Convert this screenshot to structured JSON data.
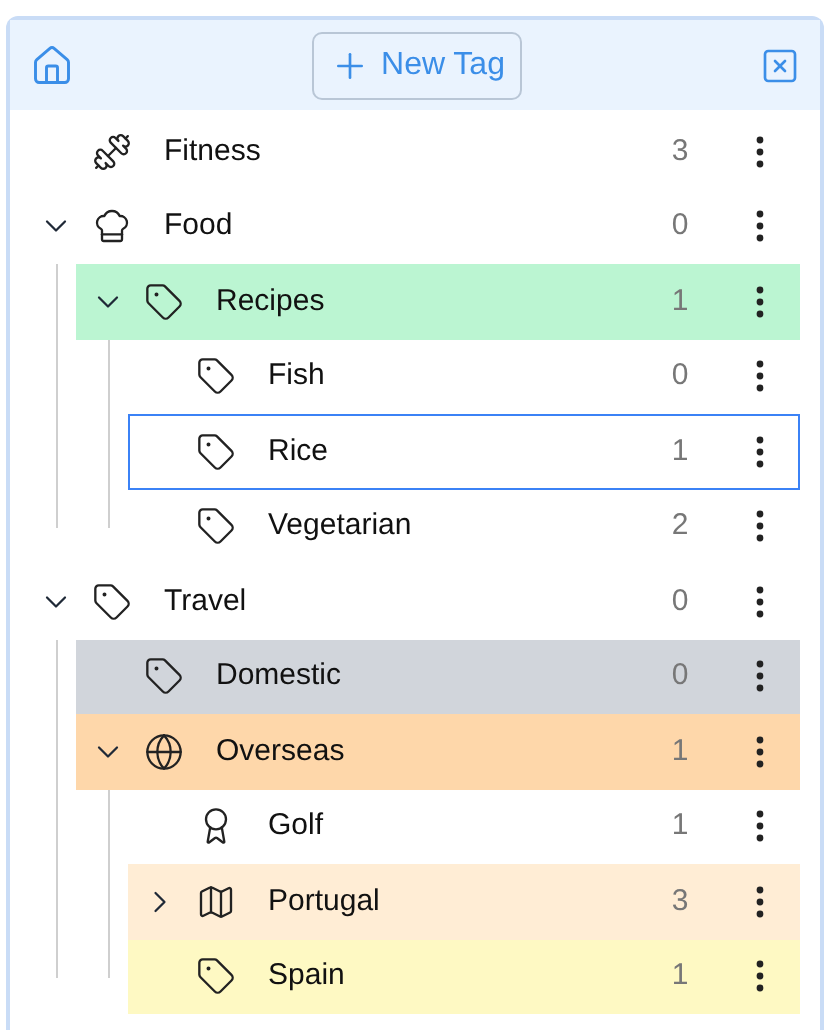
{
  "toolbar": {
    "new_button": "New Tag"
  },
  "tree": [
    {
      "label": "Fitness",
      "count": "3",
      "kind": "dumbbell",
      "expandable": false,
      "focused": false
    },
    {
      "label": "Food",
      "count": "0",
      "kind": "chef",
      "expandable": true,
      "expanded": true,
      "focused": false,
      "children": [
        {
          "label": "Recipes",
          "count": "1",
          "kind": "tag",
          "color": "#bbf5d2",
          "expandable": true,
          "expanded": true,
          "focused": false,
          "children": [
            {
              "label": "Fish",
              "count": "0",
              "kind": "tag",
              "expandable": false,
              "focused": false
            },
            {
              "label": "Rice",
              "count": "1",
              "kind": "tag",
              "expandable": false,
              "focused": true
            },
            {
              "label": "Vegetarian",
              "count": "2",
              "kind": "tag",
              "expandable": false,
              "focused": false
            }
          ]
        }
      ]
    },
    {
      "label": "Travel",
      "count": "0",
      "kind": "tag",
      "expandable": true,
      "expanded": true,
      "focused": false,
      "children": [
        {
          "label": "Domestic",
          "count": "0",
          "kind": "tag",
          "color": "#d1d5db",
          "expandable": false,
          "focused": false
        },
        {
          "label": "Overseas",
          "count": "1",
          "kind": "globe",
          "color": "#fed7aa",
          "expandable": true,
          "expanded": true,
          "focused": false,
          "children": [
            {
              "label": "Golf",
              "count": "1",
              "kind": "award",
              "expandable": false,
              "focused": false
            },
            {
              "label": "Portugal",
              "count": "3",
              "kind": "map",
              "color": "#ffedd5",
              "expandable": true,
              "expanded": false,
              "focused": false
            },
            {
              "label": "Spain",
              "count": "1",
              "kind": "tag",
              "color": "#fef9c3",
              "expandable": false,
              "focused": false
            }
          ]
        }
      ]
    }
  ]
}
